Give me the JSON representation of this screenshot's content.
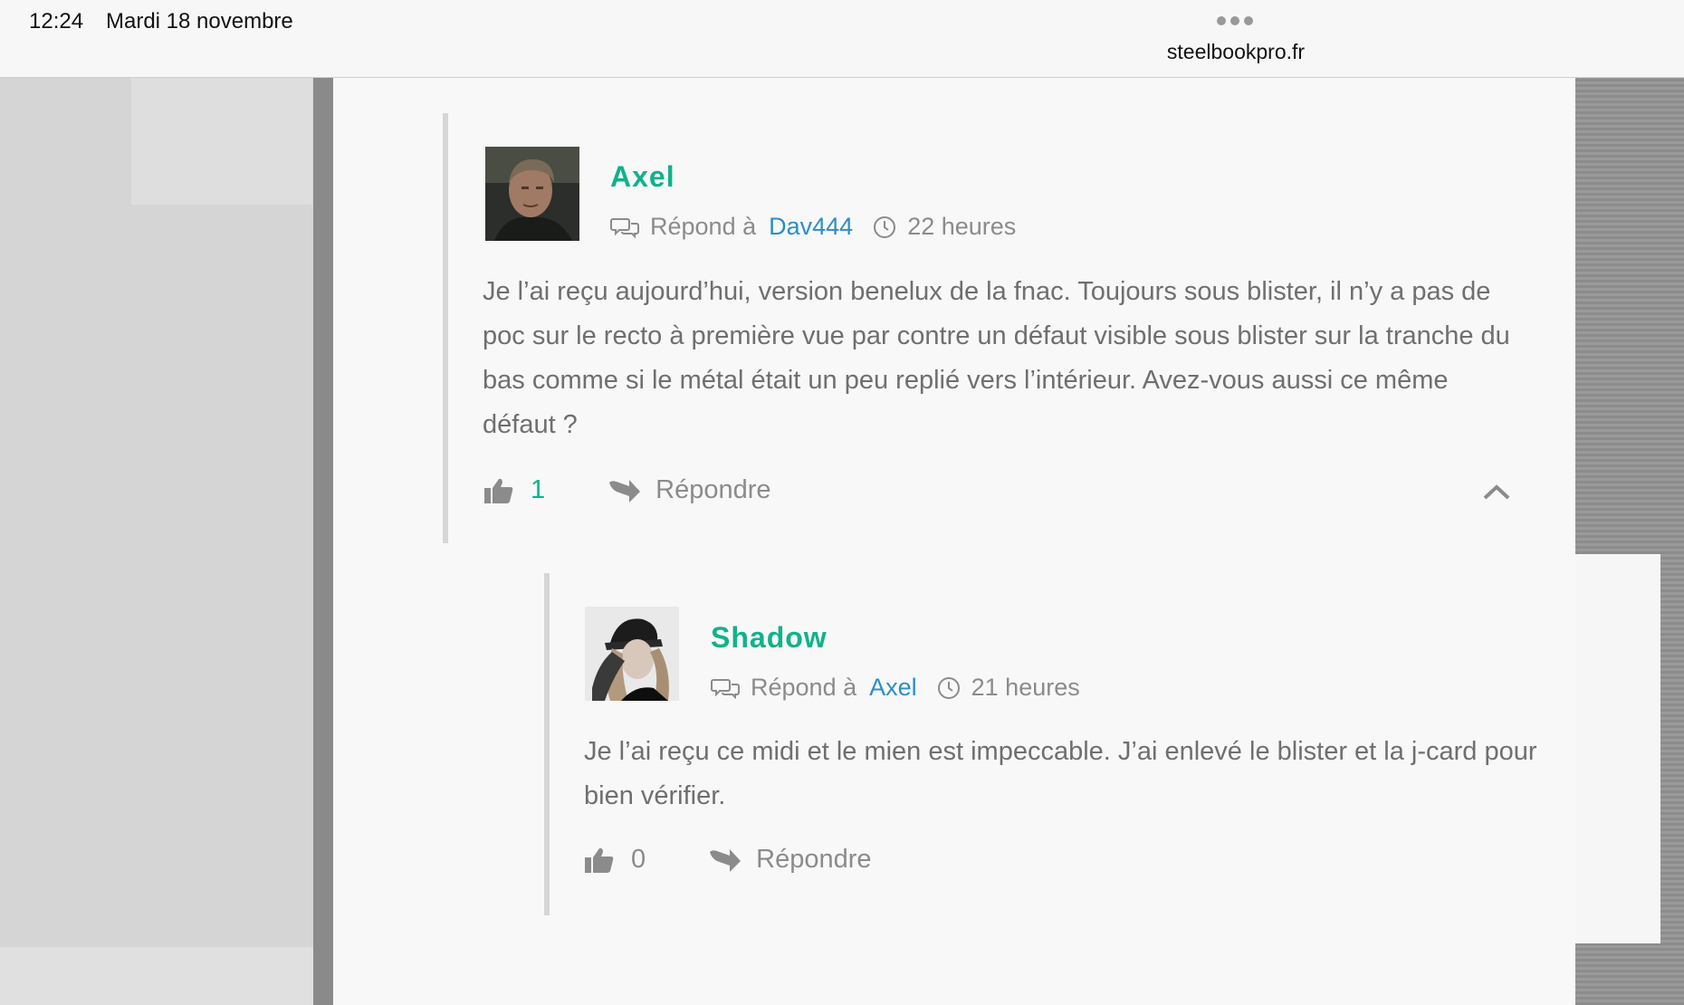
{
  "status_bar": {
    "time": "12:24",
    "date": "Mardi 18 novembre",
    "url": "steelbookpro.fr"
  },
  "comments": [
    {
      "author": "Axel",
      "reply_label": "Répond à",
      "reply_to": "Dav444",
      "time_ago": "22 heures",
      "text": "Je l’ai reçu aujourd’hui, version benelux de la fnac. Toujours sous blister, il n’y a pas de poc sur le recto à première vue par contre un défaut visible sous blister sur la tranche du bas comme si le métal était un peu replié vers l’intérieur. Avez-vous aussi ce même défaut ?",
      "likes": "1",
      "reply_button": "Répondre"
    },
    {
      "author": "Shadow",
      "reply_label": "Répond à",
      "reply_to": "Axel",
      "time_ago": "21 heures",
      "text": "Je l’ai reçu ce midi et le mien est impeccable. J’ai enlevé le blister et la j-card pour bien vérifier.",
      "likes": "0",
      "reply_button": "Répondre"
    }
  ],
  "colors": {
    "author": "#11b28b",
    "link": "#2a8fc5",
    "text": "#6f6f6f",
    "muted": "#8b8b8b"
  },
  "icons": [
    "reply-bubbles-icon",
    "clock-icon",
    "thumbs-up-icon",
    "reply-arrow-icon",
    "chevron-up-icon"
  ]
}
